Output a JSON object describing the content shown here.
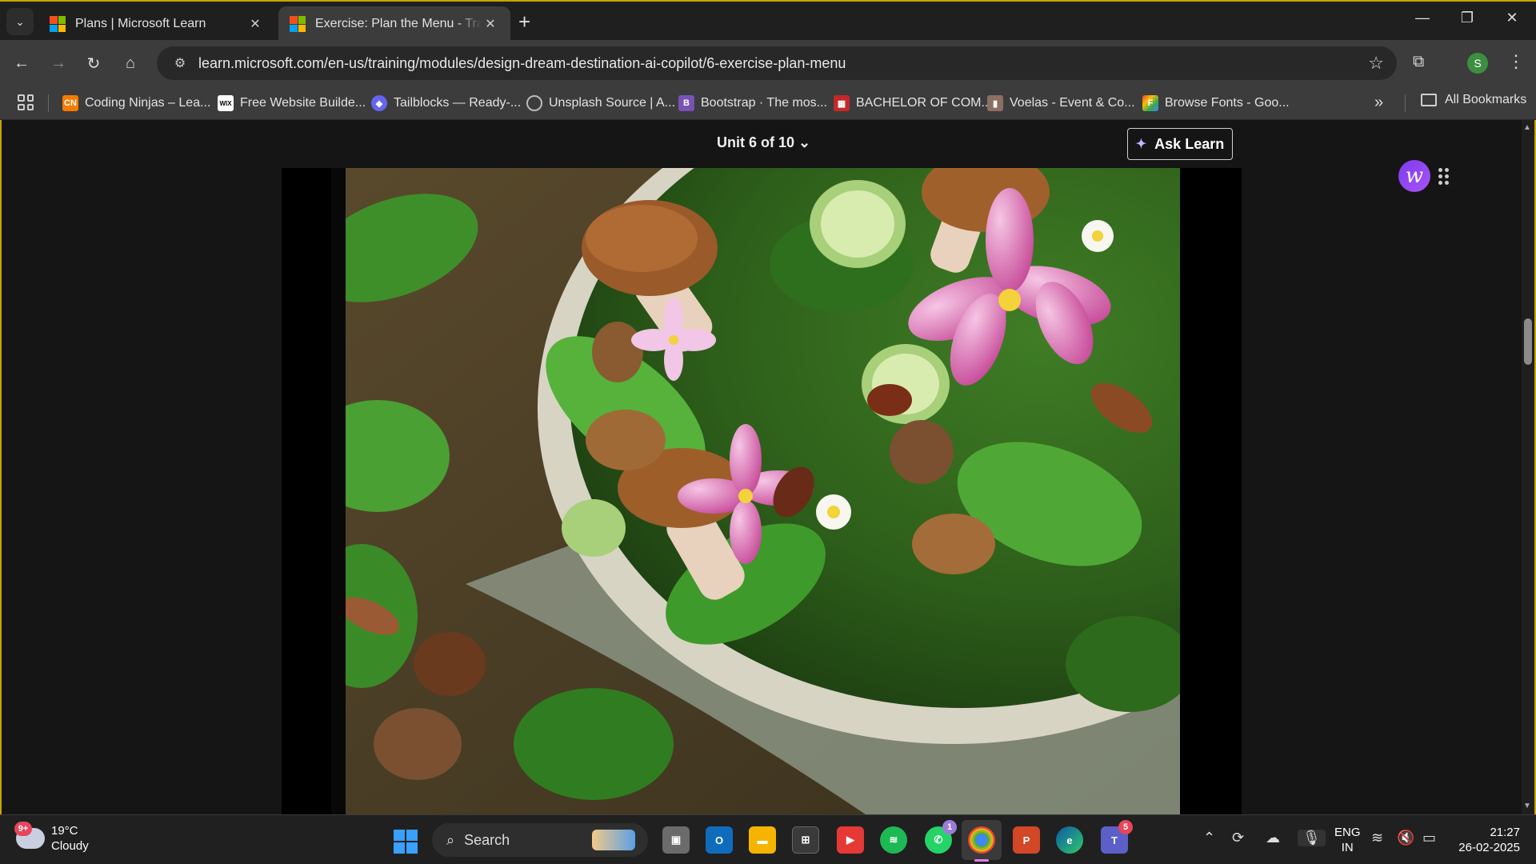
{
  "browser": {
    "tabs": [
      {
        "title": "Plans | Microsoft Learn",
        "active": false
      },
      {
        "title": "Exercise: Plan the Menu - Trainin",
        "active": true
      }
    ],
    "url": "learn.microsoft.com/en-us/training/modules/design-dream-destination-ai-copilot/6-exercise-plan-menu",
    "profile_initial": "S",
    "bookmarks": [
      {
        "label": "Coding Ninjas – Lea...",
        "icon": "coding-ninjas-icon",
        "color": "#f57c00"
      },
      {
        "label": "Free Website Builde...",
        "icon": "wix-icon",
        "color": "#ffffff"
      },
      {
        "label": "Tailblocks — Ready-...",
        "icon": "tailblocks-icon",
        "color": "#6366f1"
      },
      {
        "label": "Unsplash Source | A...",
        "icon": "globe-icon",
        "color": "#9e9e9e"
      },
      {
        "label": "Bootstrap · The mos...",
        "icon": "bootstrap-icon",
        "color": "#7952b3"
      },
      {
        "label": "BACHELOR OF COM...",
        "icon": "college-icon",
        "color": "#c62828"
      },
      {
        "label": "Voelas - Event & Co...",
        "icon": "voelas-icon",
        "color": "#8d6e63"
      },
      {
        "label": "Browse Fonts - Goo...",
        "icon": "google-fonts-icon",
        "color": "#4285f4"
      }
    ],
    "all_bookmarks_label": "All Bookmarks"
  },
  "page": {
    "unit_nav": "Unit 6 of 10",
    "ask_learn_label": "Ask Learn"
  },
  "taskbar": {
    "weather_temp": "19°C",
    "weather_desc": "Cloudy",
    "weather_badge": "9+",
    "search_label": "Search",
    "whatsapp_badge": "1",
    "teams_badge": "5",
    "lang_line1": "ENG",
    "lang_line2": "IN",
    "time": "21:27",
    "date": "26-02-2025"
  },
  "colors": {
    "accent_border": "#c9a400",
    "chrome_bg": "#3c3c3c",
    "page_bg": "#151515"
  }
}
